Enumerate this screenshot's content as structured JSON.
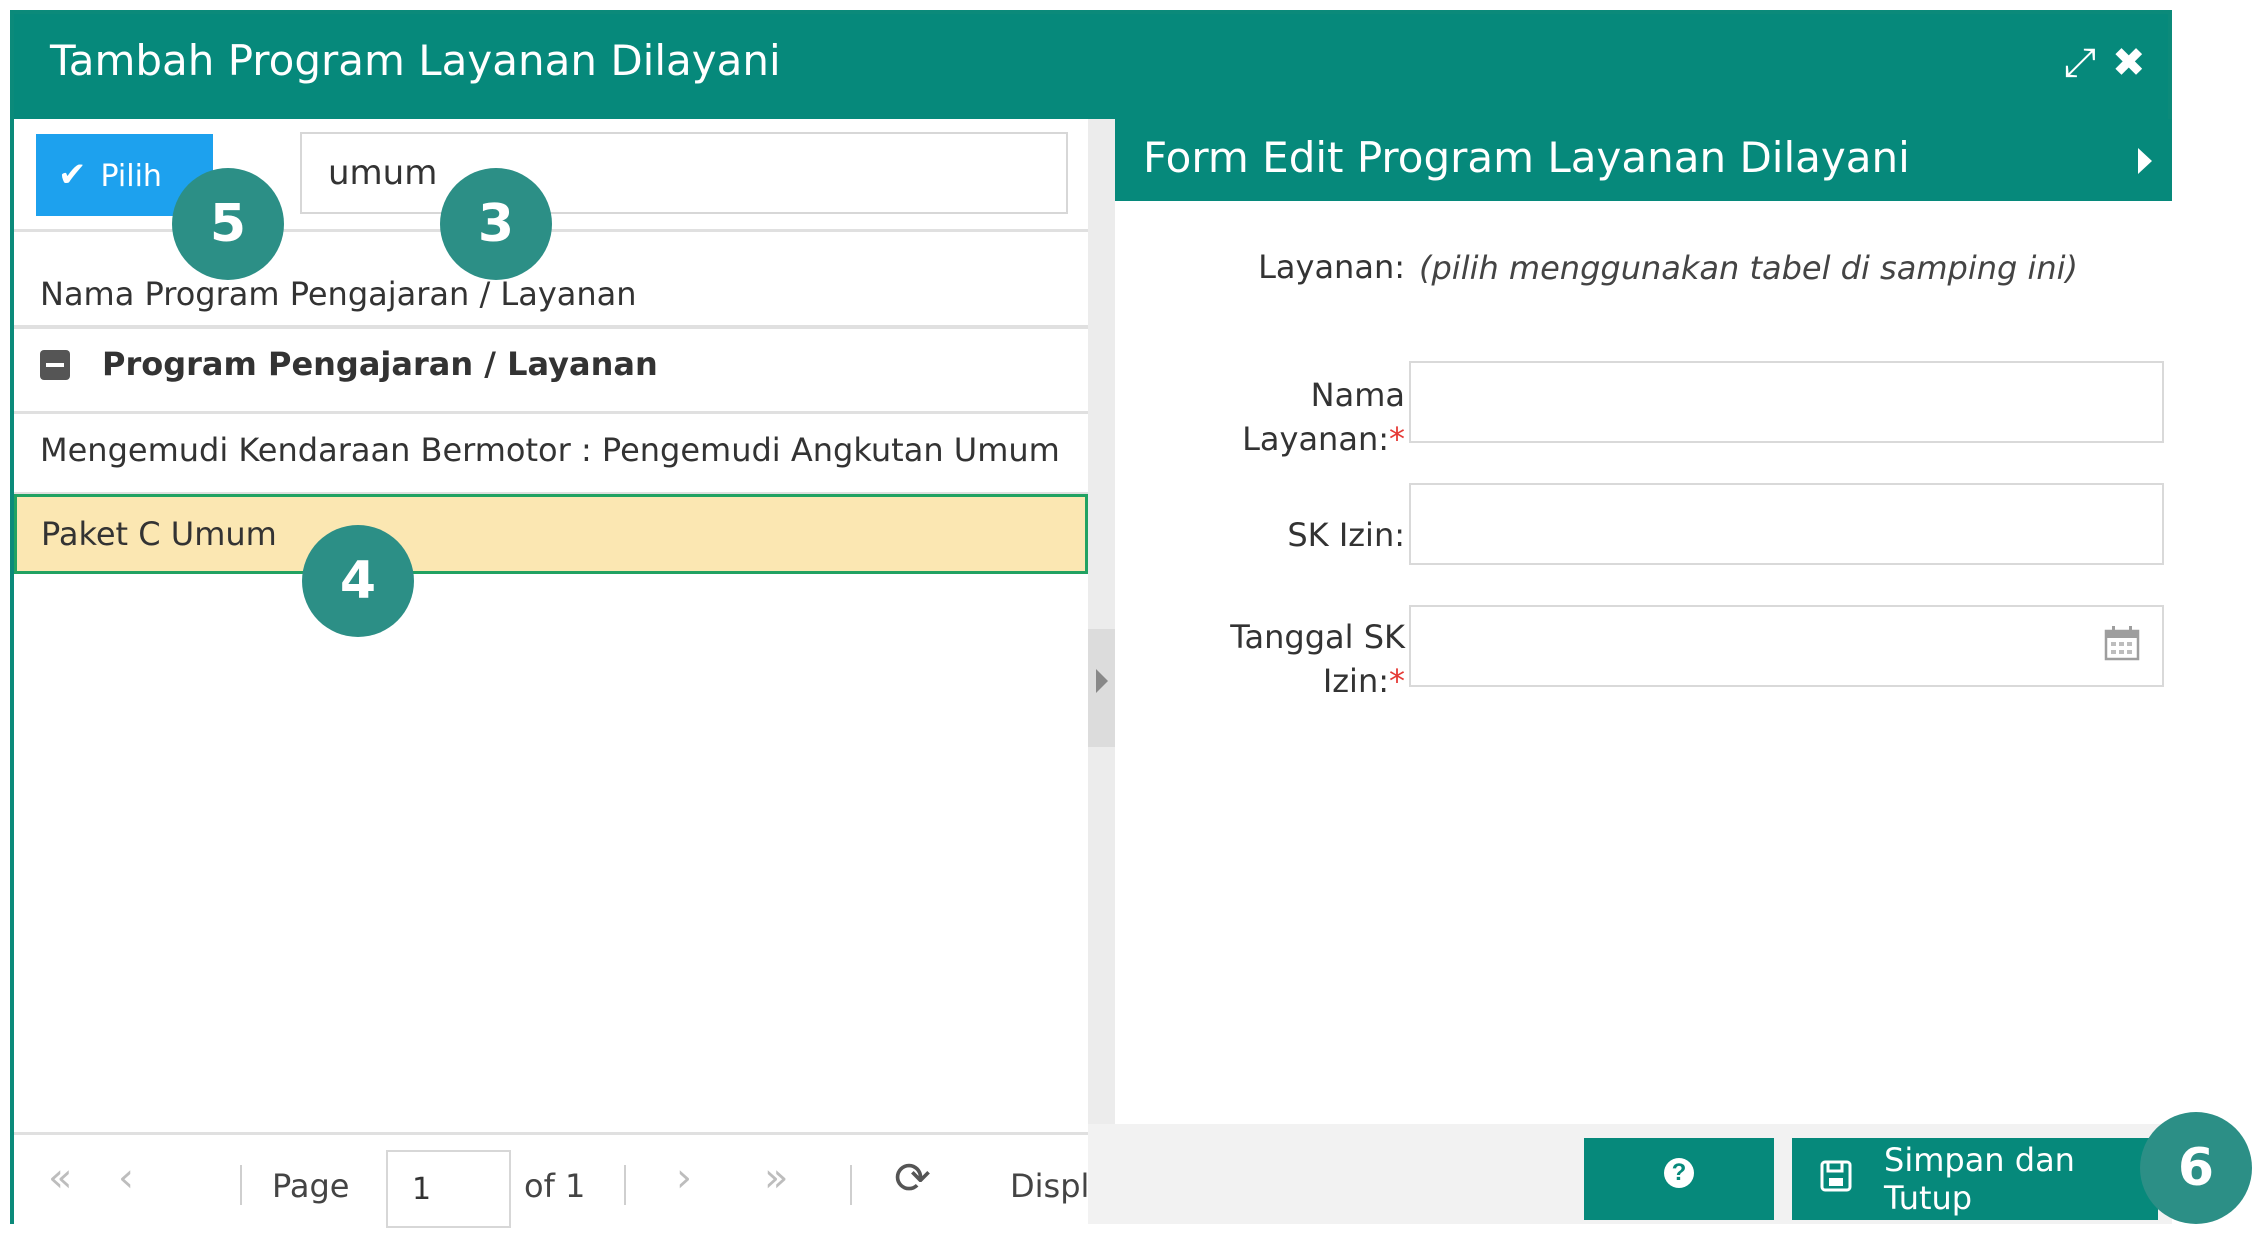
{
  "window": {
    "title": "Tambah Program Layanan Dilayani",
    "maximize_icon": "expand-icon",
    "close_icon": "close-icon"
  },
  "left": {
    "pilih_label": "Pilih",
    "search_value": "umum",
    "column_header": "Nama Program Pengajaran / Layanan",
    "group_label": "Program Pengajaran / Layanan",
    "rows": [
      "Mengemudi Kendaraan Bermotor : Pengemudi Angkutan Umum",
      "Paket C Umum"
    ],
    "pager": {
      "page_label": "Page",
      "page_value": "1",
      "of_label": "of 1",
      "display_label": "Displa"
    }
  },
  "form": {
    "title": "Form Edit Program Layanan Dilayani",
    "layanan_label": "Layanan:",
    "layanan_hint": "(pilih menggunakan tabel di samping ini)",
    "nama_label_1": "Nama",
    "nama_label_2": "Layanan:",
    "sk_label": "SK Izin:",
    "tanggal_label_1": "Tanggal SK",
    "tanggal_label_2": "Izin:",
    "required_mark": "*"
  },
  "footer": {
    "save_label": "Simpan dan Tutup",
    "help_icon": "?"
  },
  "badges": {
    "b3": "3",
    "b4": "4",
    "b5": "5",
    "b6": "6"
  },
  "colors": {
    "header": "#06897b",
    "pilih": "#1da1ee",
    "selected_row": "#fbe7b2",
    "badge": "#2c8f86"
  }
}
